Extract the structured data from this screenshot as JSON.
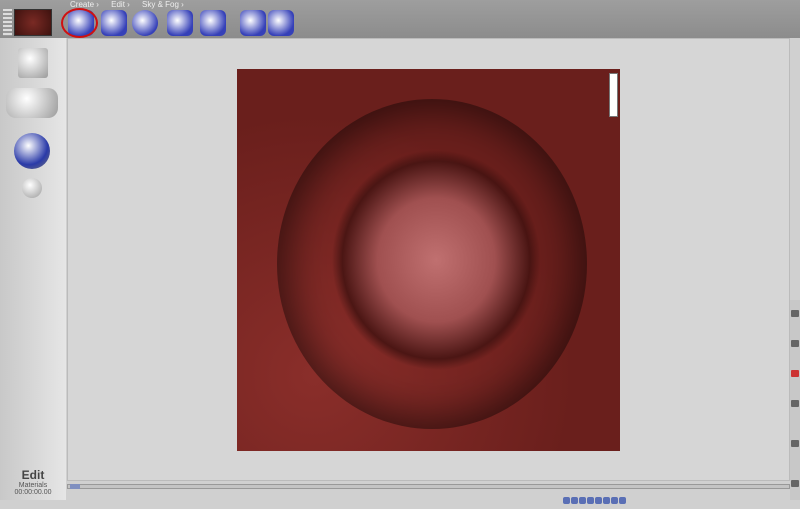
{
  "tabs": [
    "Create ›",
    "Edit ›",
    "Sky & Fog ›"
  ],
  "status": {
    "mode": "Edit",
    "section": "Materials",
    "timecode": "00:00:00.00"
  },
  "icons": {
    "thumbnail": "material-preview-thumbnail",
    "tools": [
      "terrain-cube-icon",
      "object-tool-icon",
      "terrain-sphere-icon",
      "move-rotate-icon",
      "camera-tool-icon",
      "grid-icon",
      "material-box-icon"
    ]
  },
  "colors": {
    "accent": "#3540b8",
    "highlight_circle": "#d01010",
    "terrain_base": "#7a2622"
  }
}
